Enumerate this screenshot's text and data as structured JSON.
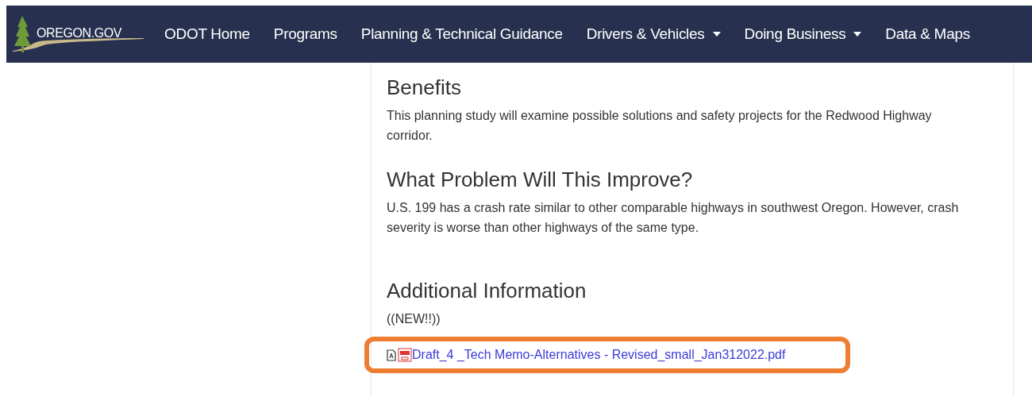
{
  "nav": {
    "logo_text": "OREGON.GOV",
    "items": [
      {
        "label": "ODOT Home",
        "dropdown": false
      },
      {
        "label": "Programs",
        "dropdown": false
      },
      {
        "label": "Planning & Technical Guidance",
        "dropdown": false
      },
      {
        "label": "Drivers & Vehicles",
        "dropdown": true
      },
      {
        "label": "Doing Business",
        "dropdown": true
      },
      {
        "label": "Data & Maps",
        "dropdown": false
      }
    ]
  },
  "sections": [
    {
      "heading": "Benefits",
      "text": "This planning study will examine possible solutions and safety projects for the Redwood Highway corridor."
    },
    {
      "heading": "What Problem Will This Improve?",
      "text": "U.S. 199 has a crash rate similar to other comparable highways in southwest Oregon. However, crash severity is worse than other highways of the same type."
    },
    {
      "heading": "Additional Information",
      "text": "((NEW!!))"
    }
  ],
  "link": {
    "label": "Draft_4 _Tech Memo-Alternatives - Revised_small_Jan312022.pdf",
    "highlighted": true
  }
}
